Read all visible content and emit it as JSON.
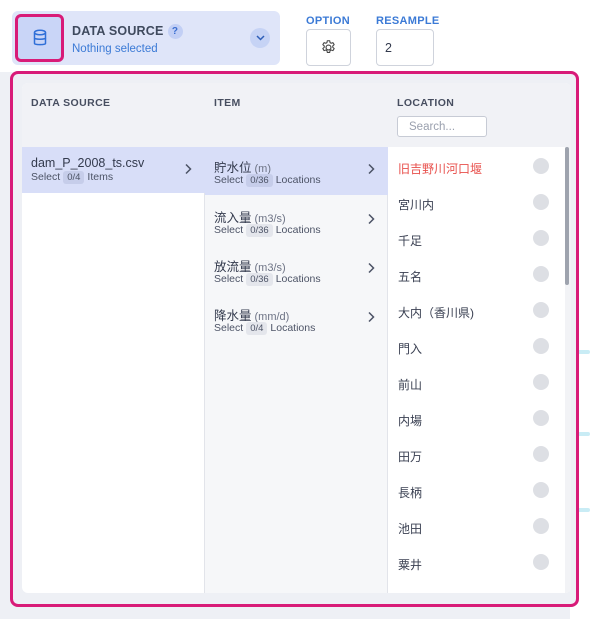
{
  "header": {
    "data_source_title": "DATA SOURCE",
    "help": "?",
    "data_source_status": "Nothing selected",
    "option_label": "OPTION",
    "resample_label": "RESAMPLE",
    "resample_value": "2"
  },
  "columns": {
    "data_source": "DATA SOURCE",
    "item": "ITEM",
    "location": "LOCATION",
    "search_placeholder": "Search..."
  },
  "sources": [
    {
      "name": "dam_P_2008_ts.csv",
      "prefix": "Select",
      "count": "0/4",
      "suffix": "Items"
    }
  ],
  "items": [
    {
      "name": "貯水位",
      "unit": "(m)",
      "prefix": "Select",
      "count": "0/36",
      "suffix": "Locations"
    },
    {
      "name": "流入量",
      "unit": "(m3/s)",
      "prefix": "Select",
      "count": "0/36",
      "suffix": "Locations"
    },
    {
      "name": "放流量",
      "unit": "(m3/s)",
      "prefix": "Select",
      "count": "0/36",
      "suffix": "Locations"
    },
    {
      "name": "降水量",
      "unit": "(mm/d)",
      "prefix": "Select",
      "count": "0/4",
      "suffix": "Locations"
    }
  ],
  "locations": [
    {
      "name": "旧吉野川河口堰"
    },
    {
      "name": "宮川内"
    },
    {
      "name": "千足"
    },
    {
      "name": "五名"
    },
    {
      "name": "大内（香川県)"
    },
    {
      "name": "門入"
    },
    {
      "name": "前山"
    },
    {
      "name": "内場"
    },
    {
      "name": "田万"
    },
    {
      "name": "長柄"
    },
    {
      "name": "池田"
    },
    {
      "name": "粟井"
    }
  ],
  "colors": {
    "accent": "#3b7ad6",
    "highlight_border": "#d81b78",
    "selected_row": "#d8def8",
    "alert_text": "#e8504c"
  }
}
